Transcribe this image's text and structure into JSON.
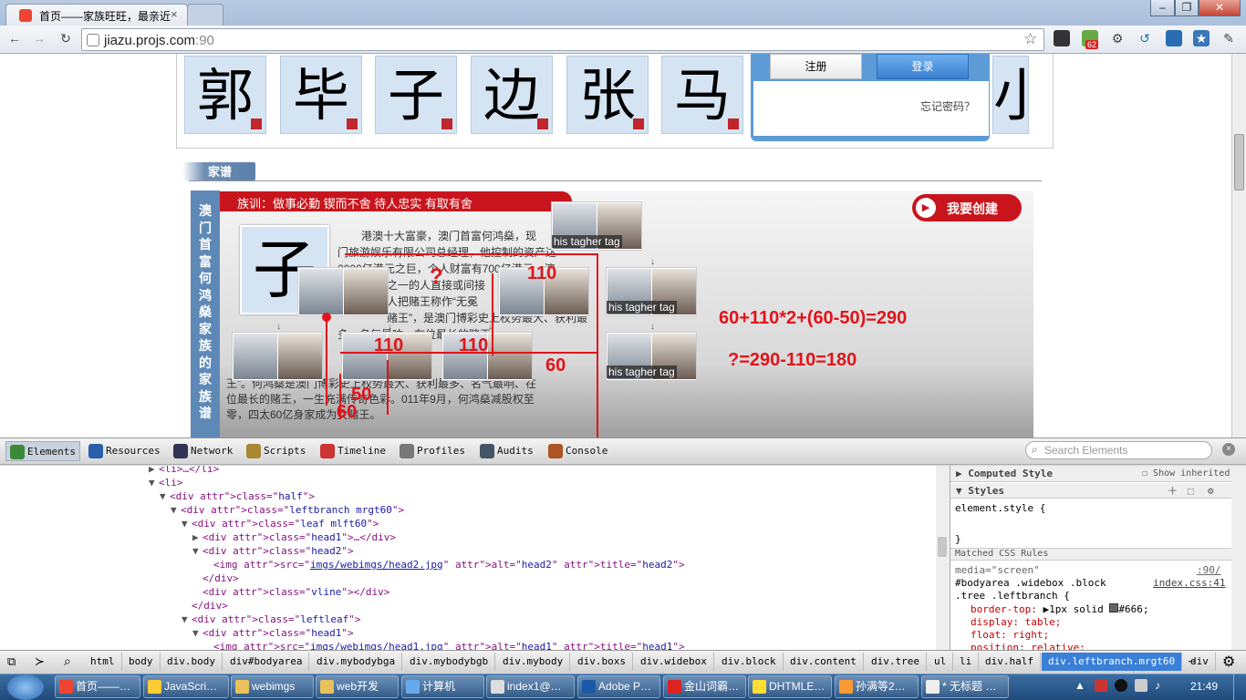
{
  "browser": {
    "tab_title": "首页——家族旺旺，最亲近",
    "url": "jiazu.projs.com",
    "url_port": ":90",
    "badge_count": "62"
  },
  "page": {
    "surnames": [
      "郭",
      "毕",
      "子",
      "边",
      "张",
      "马"
    ],
    "surname_partial": "小",
    "login": {
      "register_button": "注册",
      "login_button": "登录",
      "forgot_password": "忘记密码？"
    },
    "section_title": "家谱",
    "family_title": "澳门首富何鸿燊家族的家族谱",
    "motto": "族训：做事必勤 锲而不舍 待人忠实 有取有舍",
    "create_button": "我要创建",
    "tree_avatar_char": "子",
    "bio": "港澳十大富豪，澳门首富何鸿燊，现任澳门旅游娱乐有限公司总经理，他控制的资产达到2000亿港元之巨，个人财富有700亿港元，澳门十大富豪之一的人直接或间接。人把赌王称作“无冕澳门王”，是澳门博彩史上权势最大、获利最多、名气最响、在位最长的赌王，一生充满传奇色彩。011年9月，何鸿燊减股权至零，四太60亿身家成为女赌王。",
    "bio_visible_lines": [
      "港澳十大富豪，澳门首富何鸿燊，现",
      "门旅游娱乐有限公司总经理，他控制的资产达",
      "2000亿港元之巨，个人财富有700亿港元，澳",
      "之一的人直接或间接",
      "人把赌王称作“无冕",
      "赌王”，是澳门博彩史上权势最大、获利最",
      "多、名气最响、在位最长的赌王",
      "王”。何鸿燊是澳门博彩史上权势最大、获利最多、名气最响、在",
      "位最长的赌王，一生充满传奇色彩。011年9月，何鸿燊减股权至",
      "零，四太60亿身家成为女赌王。"
    ],
    "node_tag": "his  tagher tag",
    "annotations": {
      "formula1": "60+110*2+(60-50)=290",
      "formula2": "?=290-110=180",
      "n110a": "110",
      "n110b": "110",
      "n110c": "110",
      "n60a": "60",
      "n50": "50",
      "n60b": "60",
      "n_q": "?"
    }
  },
  "devtools": {
    "tabs": [
      "Elements",
      "Resources",
      "Network",
      "Scripts",
      "Timeline",
      "Profiles",
      "Audits",
      "Console"
    ],
    "search_placeholder": "Search Elements",
    "dom_lines": [
      {
        "indent": 0,
        "arrow": "▶",
        "html": "<li>…</li>"
      },
      {
        "indent": 0,
        "arrow": "▼",
        "html": "<li>"
      },
      {
        "indent": 1,
        "arrow": "▼",
        "html": "<div class=\"half\">"
      },
      {
        "indent": 2,
        "arrow": "▼",
        "html": "<div class=\"leftbranch mrgt60\">"
      },
      {
        "indent": 3,
        "arrow": "▼",
        "html": "<div class=\"leaf mlft60\">"
      },
      {
        "indent": 4,
        "arrow": "▶",
        "html": "<div class=\"head1\">…</div>"
      },
      {
        "indent": 4,
        "arrow": "▼",
        "html": "<div class=\"head2\">"
      },
      {
        "indent": 5,
        "arrow": "",
        "html": "<img src=\"imgs/webimgs/head2.jpg\" alt=\"head2\" title=\"head2\">"
      },
      {
        "indent": 4,
        "arrow": "",
        "html": "</div>"
      },
      {
        "indent": 4,
        "arrow": "",
        "html": "<div class=\"vline\"></div>"
      },
      {
        "indent": 3,
        "arrow": "",
        "html": "</div>"
      },
      {
        "indent": 3,
        "arrow": "▼",
        "html": "<div class=\"leftleaf\">"
      },
      {
        "indent": 4,
        "arrow": "▼",
        "html": "<div class=\"head1\">"
      },
      {
        "indent": 5,
        "arrow": "",
        "html": "<img src=\"imgs/webimgs/head1.jpg\" alt=\"head1\" title=\"head1\">"
      }
    ],
    "sidebar": {
      "computed_style": "Computed Style",
      "show_inherited": "Show inherited",
      "styles": "Styles",
      "element_style": "element.style {",
      "close_brace": "}",
      "matched_rules": "Matched CSS Rules",
      "media": "media=\"screen\"",
      "media_src": ":90/",
      "selector1": "#bodyarea .widebox .block",
      "selector2": ".tree .leftbranch {",
      "rule_src": "index.css:41",
      "prop1_name": "border-top:",
      "prop1_value": "1px solid ",
      "prop1_color": "#666;",
      "prop2": "display: table;",
      "prop3": "float: right;",
      "prop4": "position: relative;"
    },
    "breadcrumbs": [
      "html",
      "body",
      "div.body",
      "div#bodyarea",
      "div.mybodybga",
      "div.mybodybgb",
      "div.mybody",
      "div.boxs",
      "div.widebox",
      "div.block",
      "div.content",
      "div.tree",
      "ul",
      "li",
      "div.half",
      "div.leftbranch.mrgt60",
      "div"
    ]
  },
  "taskbar": {
    "items": [
      "首页——…",
      "JavaScri…",
      "webimgs",
      "web开发",
      "计算机",
      "index1@…",
      "Adobe P…",
      "金山词霸…",
      "DHTMLE…",
      "孙满等2…",
      "* 无标题 …"
    ],
    "clock": "21:49"
  }
}
